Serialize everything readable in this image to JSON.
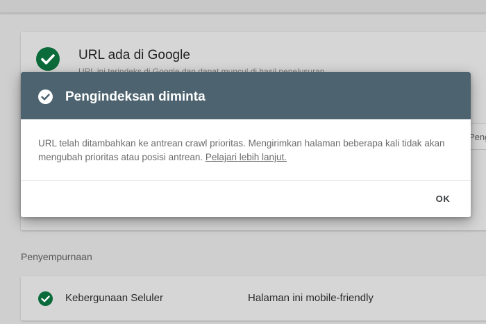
{
  "status_card": {
    "title": "URL ada di Google",
    "subtitle_partial": "URL ini terindeks di Google dan dapat muncul di hasil penelusuran",
    "check_icon": "check-circle-icon",
    "side_button_partial": "Peng"
  },
  "enhancements": {
    "section_label": "Penyempurnaan",
    "rows": [
      {
        "name": "Kebergunaan Seluler",
        "value": "Halaman ini mobile-friendly",
        "icon": "check-circle-icon",
        "status_color": "#0b6b3a"
      }
    ]
  },
  "dialog": {
    "title": "Pengindeksan diminta",
    "body": "URL telah ditambahkan ke antrean crawl prioritas. Mengirimkan halaman beberapa kali tidak akan mengubah prioritas atau posisi antrean.",
    "link_label": "Pelajari lebih lanjut.",
    "ok_label": "OK",
    "header_color": "#4d6470",
    "icon": "check-circle-icon"
  }
}
